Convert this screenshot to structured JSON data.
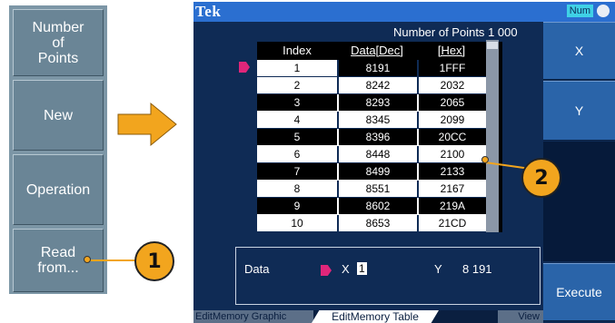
{
  "left_softkeys": [
    "Number\nof\nPoints",
    "New",
    "Operation",
    "Read\nfrom..."
  ],
  "callouts": [
    "1",
    "2"
  ],
  "screen": {
    "brand": "Tek",
    "num_indicator": "Num",
    "points_label": "Number of Points",
    "points_value": "1 000",
    "table": {
      "headers": [
        "Index",
        "Data[Dec]",
        "[Hex]"
      ],
      "rows": [
        [
          "1",
          "8191",
          "1FFF"
        ],
        [
          "2",
          "8242",
          "2032"
        ],
        [
          "3",
          "8293",
          "2065"
        ],
        [
          "4",
          "8345",
          "2099"
        ],
        [
          "5",
          "8396",
          "20CC"
        ],
        [
          "6",
          "8448",
          "2100"
        ],
        [
          "7",
          "8499",
          "2133"
        ],
        [
          "8",
          "8551",
          "2167"
        ],
        [
          "9",
          "8602",
          "219A"
        ],
        [
          "10",
          "8653",
          "21CD"
        ]
      ]
    },
    "data_box": {
      "label": "Data",
      "x_label": "X",
      "x_value": "1",
      "y_label": "Y",
      "y_value": "8 191"
    },
    "right_softkeys": [
      "X",
      "Y",
      "",
      "Execute"
    ],
    "tabs": [
      "EditMemory Graphic",
      "EditMemory Table",
      "View"
    ],
    "colors": {
      "accent": "#f2a51e",
      "cursor": "#e0267a",
      "screen_bg": "#0f2b55"
    }
  }
}
